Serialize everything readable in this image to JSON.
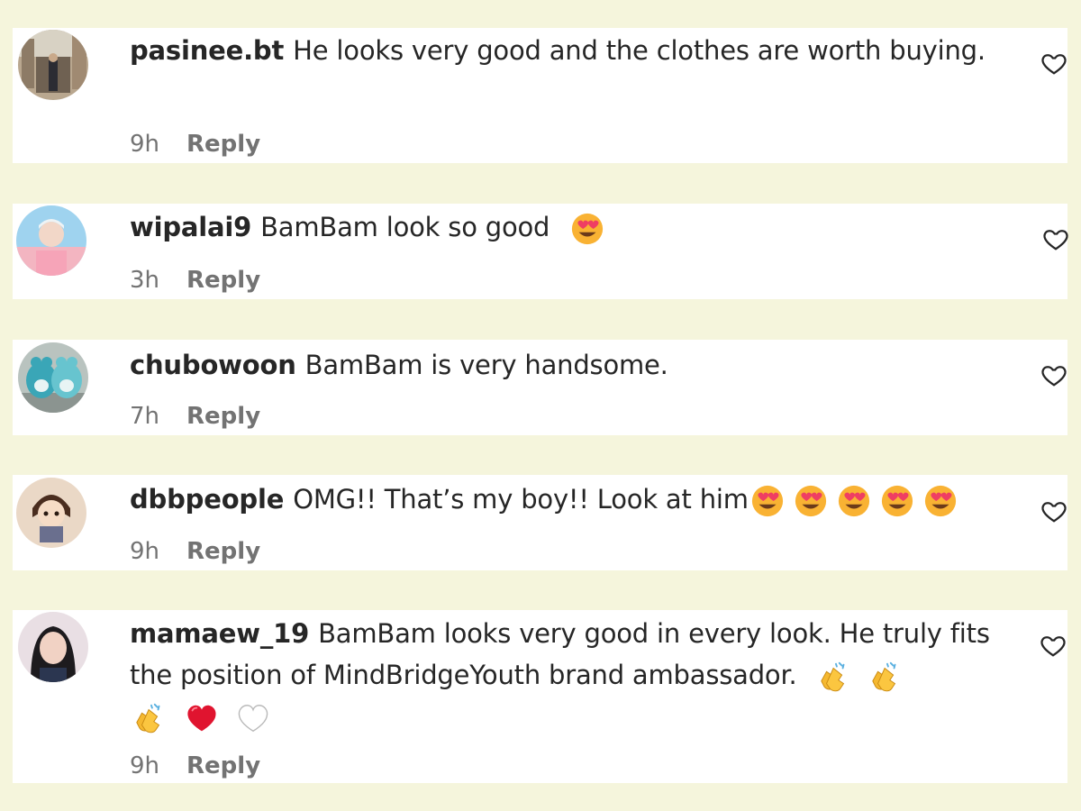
{
  "reply_label": "Reply",
  "comments": [
    {
      "username": "pasinee.bt",
      "text": "He looks very good and the clothes are worth buying.",
      "time": "9h",
      "emojis": []
    },
    {
      "username": "wipalai9",
      "text": "BamBam look so good",
      "time": "3h",
      "emojis": [
        "heart-eyes-emoji"
      ]
    },
    {
      "username": "chubowoon",
      "text": "BamBam is very handsome.",
      "time": "7h",
      "emojis": []
    },
    {
      "username": "dbbpeople",
      "text": "OMG!! That’s my boy!! Look at him",
      "time": "9h",
      "emojis": [
        "heart-eyes-emoji",
        "heart-eyes-emoji",
        "heart-eyes-emoji",
        "heart-eyes-emoji",
        "heart-eyes-emoji"
      ]
    },
    {
      "username": "mamaew_19",
      "text": "BamBam looks very good in every look. He truly fits the position of MindBridgeYouth brand ambassador.",
      "time": "9h",
      "emojis": [
        "clapping-hands-emoji",
        "clapping-hands-emoji",
        "clapping-hands-emoji",
        "red-heart-emoji",
        "white-heart-emoji"
      ]
    }
  ],
  "colors": {
    "background": "#f5f5dc",
    "card": "#ffffff",
    "text": "#262626",
    "muted": "#737373"
  }
}
